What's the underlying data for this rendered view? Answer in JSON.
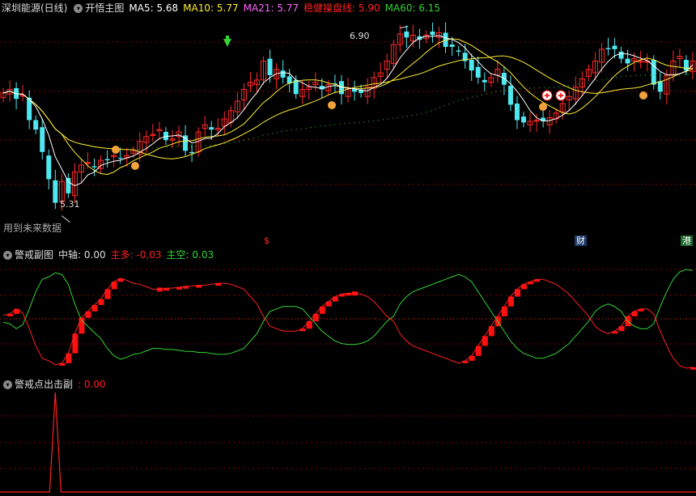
{
  "colors": {
    "bg": "#000000",
    "up": "#ff2a2a",
    "down": "#4fe8f0",
    "ma5": "#ffffff",
    "ma10": "#ffee33",
    "ma21": "#ff44ff",
    "ma60": "#35d235",
    "stable": "#ff2020",
    "grid": "#8a0000"
  },
  "main_header": {
    "stock": "深圳能源(日线)",
    "chart_name": "开悟主图",
    "ma5_label": "MA5:",
    "ma5_value": "5.68",
    "ma10_label": "MA10:",
    "ma10_value": "5.77",
    "ma21_label": "MA21:",
    "ma21_value": "5.77",
    "stable_label": "稳健操盘线:",
    "stable_value": "5.90",
    "ma60_label": "MA60:",
    "ma60_value": "6.15",
    "future_note": "用到未来数据",
    "high_label": "6.90",
    "low_label": "5.31",
    "tag_s": "$",
    "tag_cai": "财",
    "tag_gang": "港",
    "collapse_icon": "chevron-down-icon"
  },
  "warn_header": {
    "name": "警戒副图",
    "axis_label": "中轴:",
    "axis_value": "0.00",
    "bull_label": "主多:",
    "bull_value": "-0.03",
    "bear_label": "主空:",
    "bear_value": "0.03"
  },
  "point_header": {
    "name": "警戒点出击副",
    "value": ": 0.00"
  },
  "chart_data": [
    {
      "type": "candlestick",
      "title": "深圳能源(日线)",
      "series": [
        {
          "name": "MA5"
        },
        {
          "name": "MA10"
        },
        {
          "name": "MA21"
        },
        {
          "name": "稳健操盘线"
        },
        {
          "name": "MA60"
        }
      ],
      "ylim": [
        5.15,
        7.0
      ],
      "count": 107,
      "closes": [
        6.35,
        6.38,
        6.3,
        6.33,
        6.12,
        6.04,
        5.85,
        5.62,
        5.42,
        5.6,
        5.5,
        5.68,
        5.74,
        5.76,
        5.72,
        5.78,
        5.78,
        5.82,
        5.8,
        5.82,
        5.86,
        5.94,
        5.98,
        6.0,
        6.04,
        5.95,
        5.96,
        6.02,
        5.86,
        5.84,
        6.02,
        6.08,
        6.04,
        6.05,
        6.13,
        6.2,
        6.28,
        6.38,
        6.44,
        6.46,
        6.62,
        6.5,
        6.55,
        6.48,
        6.43,
        6.34,
        6.38,
        6.4,
        6.44,
        6.38,
        6.42,
        6.42,
        6.34,
        6.39,
        6.36,
        6.35,
        6.4,
        6.48,
        6.52,
        6.62,
        6.76,
        6.85,
        6.82,
        6.84,
        6.8,
        6.84,
        6.84,
        6.86,
        6.74,
        6.74,
        6.7,
        6.62,
        6.54,
        6.48,
        6.44,
        6.48,
        6.55,
        6.42,
        6.25,
        6.12,
        6.1,
        6.11,
        6.12,
        6.11,
        6.14,
        6.18,
        6.26,
        6.32,
        6.4,
        6.47,
        6.55,
        6.62,
        6.72,
        6.72,
        6.72,
        6.64,
        6.6,
        6.64,
        6.62,
        6.62,
        6.42,
        6.36,
        6.5,
        6.62,
        6.66,
        6.54,
        6.62
      ],
      "low_marker": {
        "value": 5.31,
        "index": 9
      },
      "high_marker": {
        "value": 6.9,
        "index": 61
      }
    },
    {
      "type": "line",
      "title": "警戒副图",
      "series": [
        {
          "name": "主多",
          "color": "#ff2020"
        },
        {
          "name": "主空",
          "color": "#35d235"
        }
      ],
      "axis": 0,
      "ylim": [
        -1,
        1
      ],
      "bull": [
        0.07,
        0.1,
        0.2,
        0.12,
        -0.2,
        -0.55,
        -0.8,
        -0.85,
        -0.93,
        -0.9,
        -0.7,
        -0.3,
        0.02,
        0.15,
        0.28,
        0.4,
        0.6,
        0.75,
        0.82,
        0.78,
        0.72,
        0.7,
        0.65,
        0.6,
        0.6,
        0.62,
        0.62,
        0.64,
        0.66,
        0.66,
        0.68,
        0.68,
        0.7,
        0.72,
        0.72,
        0.7,
        0.65,
        0.6,
        0.45,
        0.3,
        0.05,
        -0.15,
        -0.2,
        -0.25,
        -0.25,
        -0.25,
        -0.2,
        -0.05,
        0.1,
        0.25,
        0.35,
        0.45,
        0.5,
        0.52,
        0.52,
        0.5,
        0.45,
        0.35,
        0.2,
        0.05,
        -0.05,
        -0.3,
        -0.45,
        -0.55,
        -0.6,
        -0.65,
        -0.7,
        -0.75,
        -0.8,
        -0.85,
        -0.9,
        -0.85,
        -0.75,
        -0.55,
        -0.35,
        -0.15,
        0.05,
        0.25,
        0.45,
        0.6,
        0.7,
        0.75,
        0.8,
        0.8,
        0.75,
        0.7,
        0.6,
        0.5,
        0.35,
        0.2,
        0.05,
        -0.15,
        -0.25,
        -0.3,
        -0.25,
        -0.15,
        0.05,
        0.15,
        0.2,
        0.2,
        0.1,
        -0.25,
        -0.55,
        -0.8,
        -0.95,
        -1.0,
        -0.98
      ],
      "bear_is_negated_bull": true
    },
    {
      "type": "line",
      "title": "警戒点出击副",
      "series": [
        {
          "name": "警戒点出击",
          "color": "#ff2020"
        }
      ],
      "ylim": [
        0,
        1
      ],
      "spike_index": 8,
      "spike_value": 1
    }
  ]
}
